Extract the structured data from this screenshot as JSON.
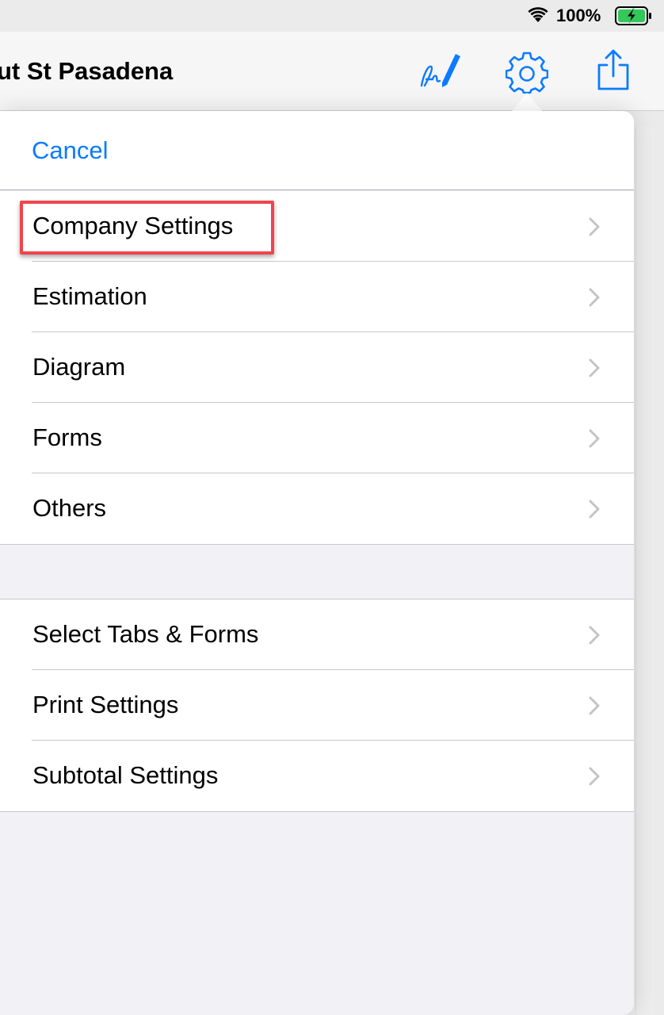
{
  "status_bar": {
    "battery_percent": "100%",
    "wifi_icon": "wifi-icon",
    "battery_icon": "battery-charging-icon",
    "battery_color": "#34c759"
  },
  "nav_bar": {
    "title": "ut St Pasadena",
    "icons": [
      "signature-icon",
      "gear-icon",
      "share-icon"
    ],
    "accent_color": "#0a7bff"
  },
  "popover": {
    "cancel_label": "Cancel",
    "group1": [
      {
        "label": "Company Settings",
        "highlighted": true
      },
      {
        "label": "Estimation"
      },
      {
        "label": "Diagram"
      },
      {
        "label": "Forms"
      },
      {
        "label": "Others"
      }
    ],
    "group2": [
      {
        "label": "Select Tabs & Forms"
      },
      {
        "label": "Print Settings"
      },
      {
        "label": "Subtotal Settings"
      }
    ],
    "highlight_color": "#f0444e"
  }
}
